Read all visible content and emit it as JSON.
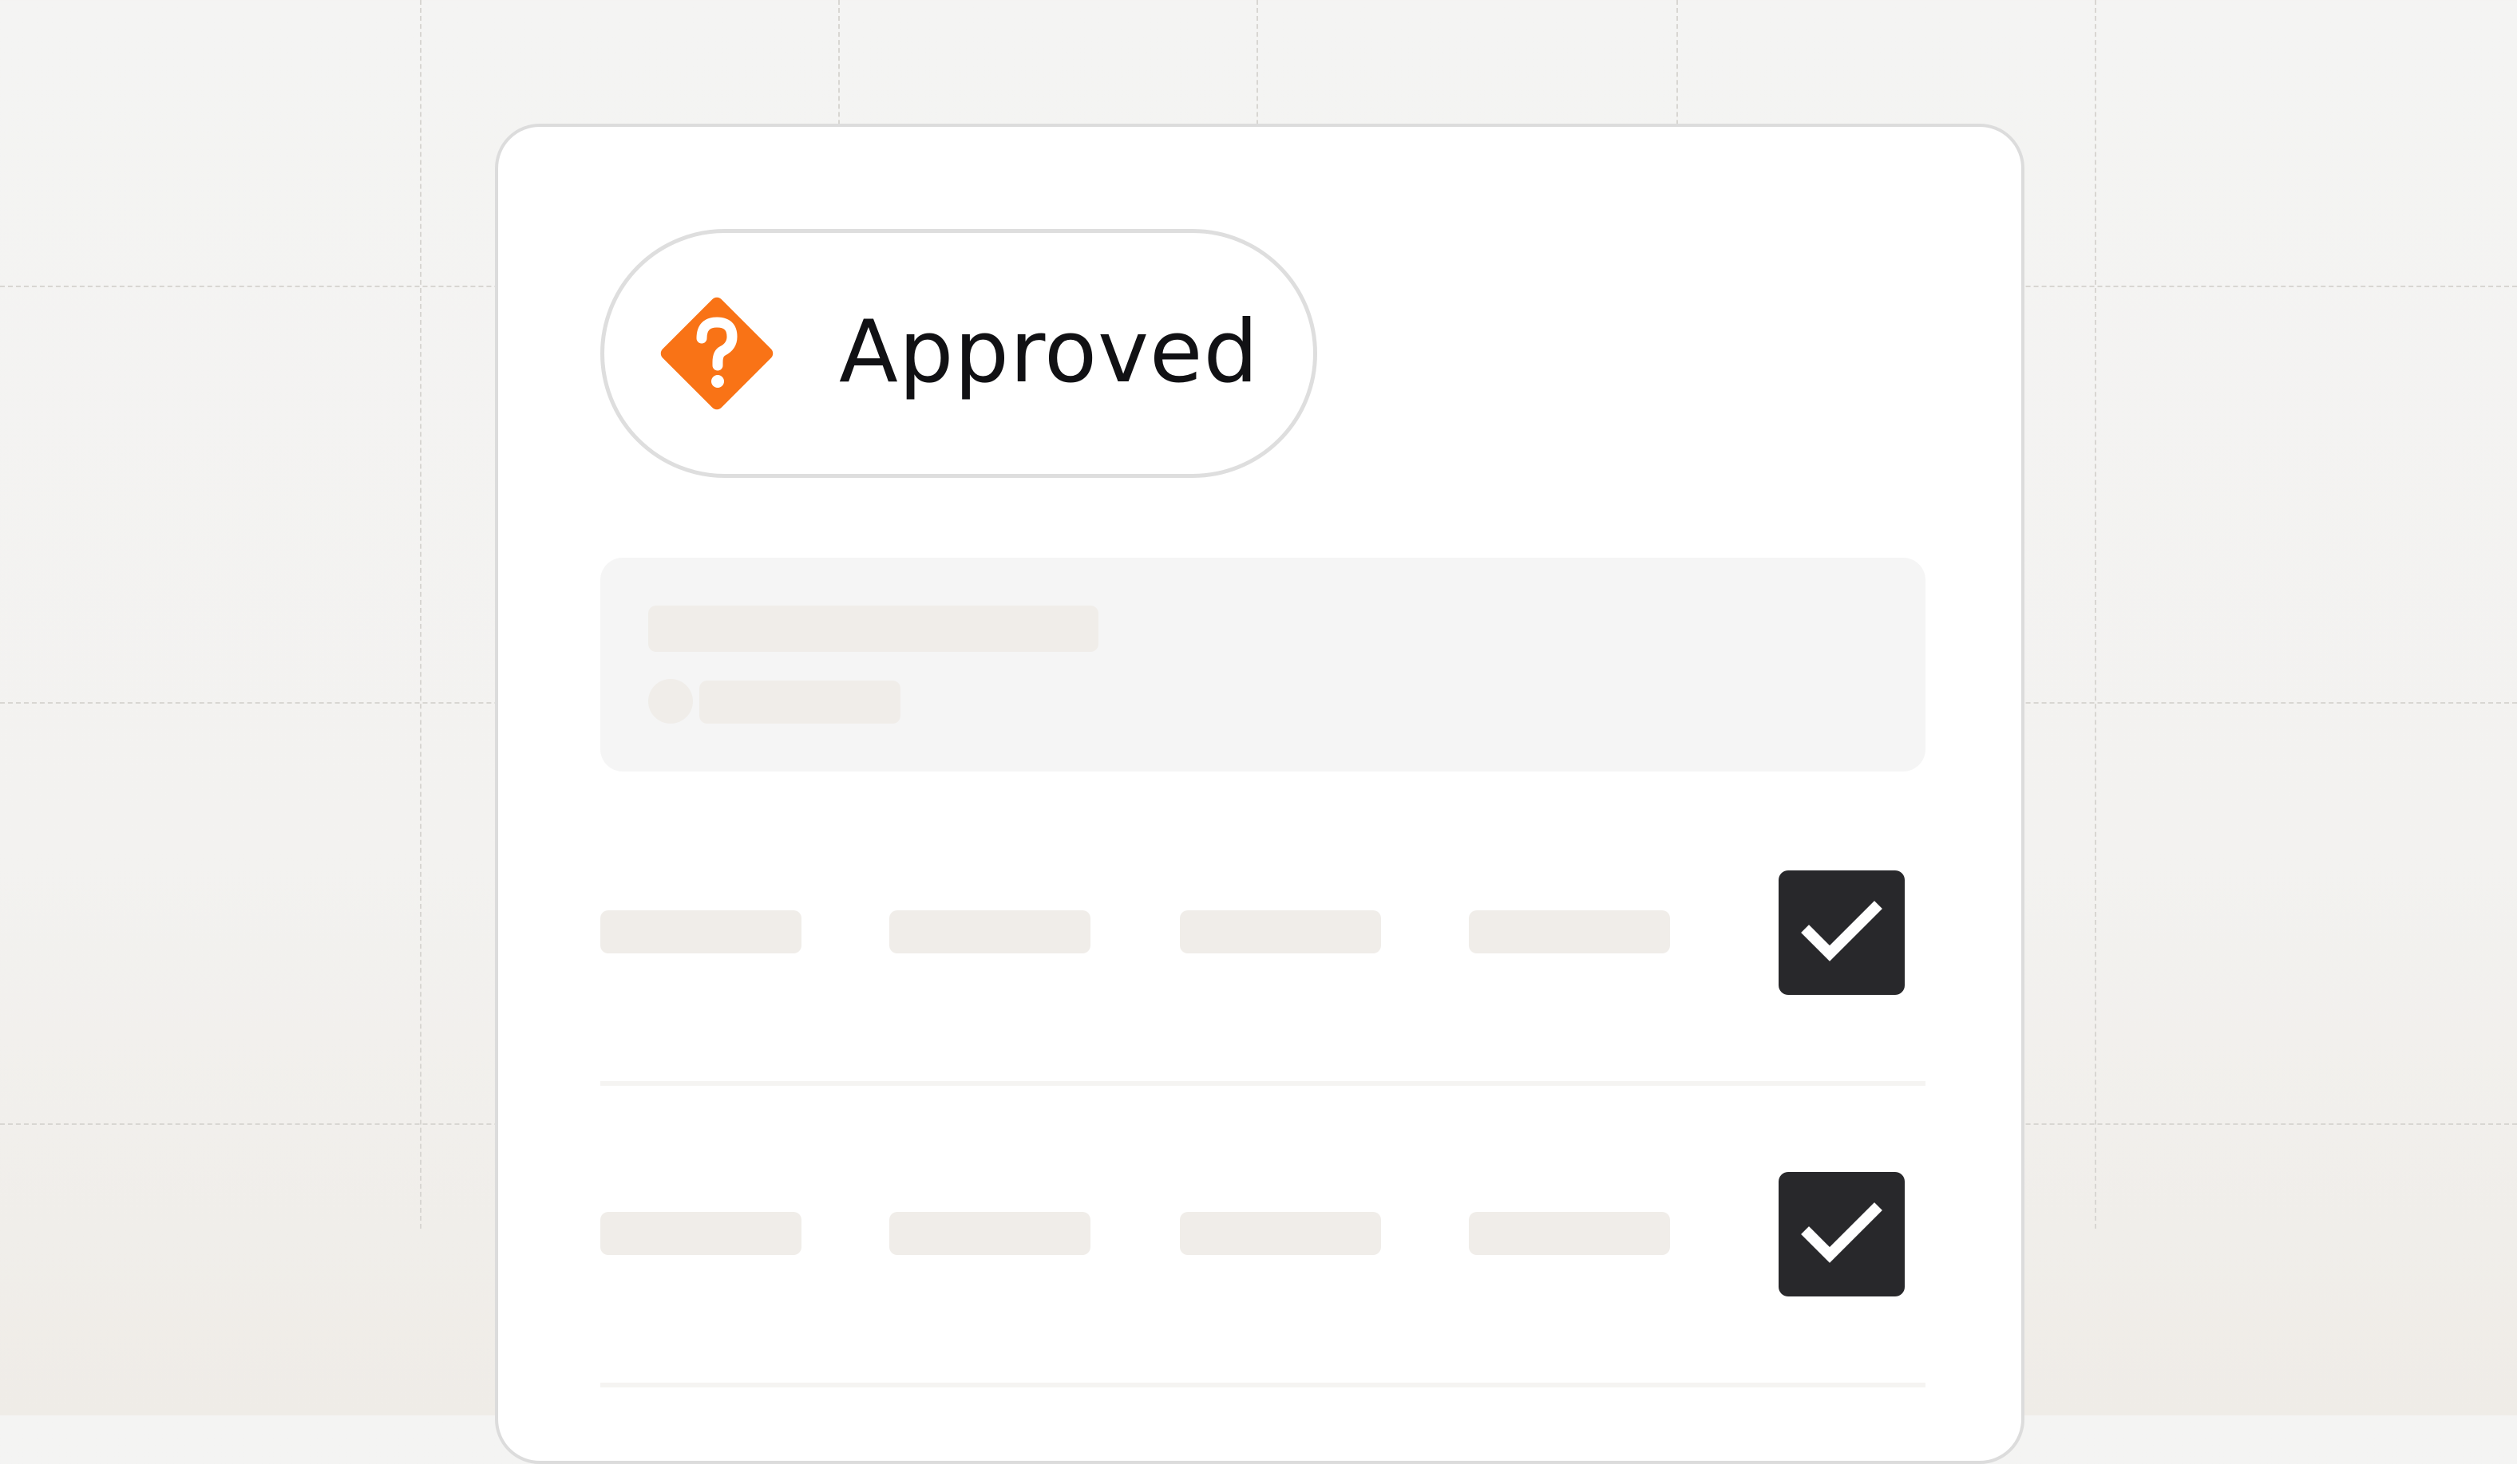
{
  "status_badge": {
    "label": "Approved",
    "icon": "question-diamond-icon",
    "icon_color": "#f97316",
    "border_color": "#dedede"
  },
  "rows": [
    {
      "checked": true
    },
    {
      "checked": true
    }
  ],
  "colors": {
    "checkbox_fill": "#28282b",
    "check_mark": "#ffffff",
    "placeholder": "#f0ede9",
    "summary_background": "#f5f5f5"
  }
}
